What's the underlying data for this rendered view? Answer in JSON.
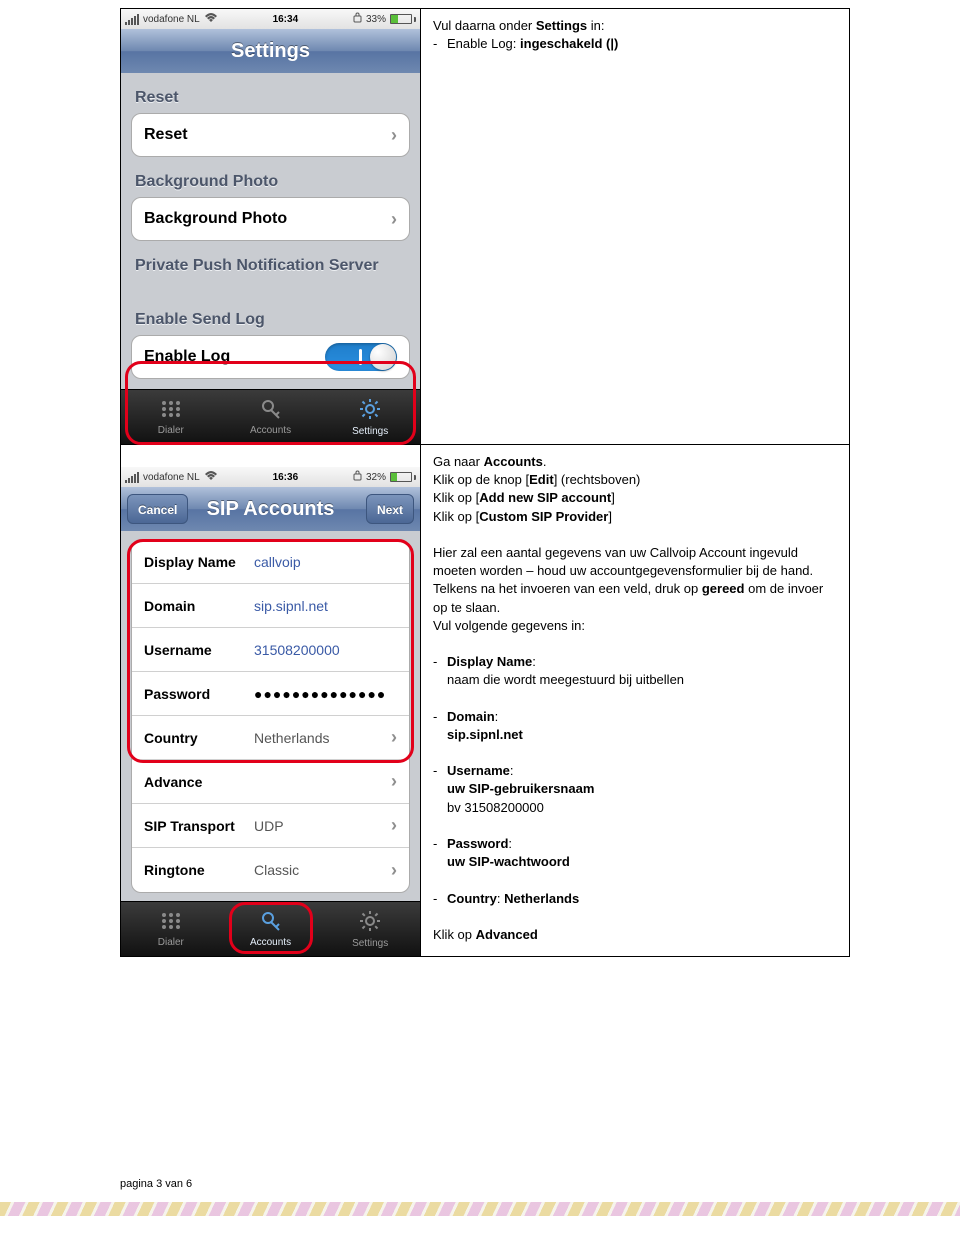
{
  "row1": {
    "statusbar": {
      "carrier": "vodafone NL",
      "time": "16:34",
      "battery_pct": "33%"
    },
    "navbar_title": "Settings",
    "groups": {
      "reset": {
        "header": "Reset",
        "cell": "Reset"
      },
      "bg": {
        "header": "Background Photo",
        "cell": "Background Photo"
      },
      "push": {
        "header": "Private Push Notification Server"
      },
      "log": {
        "header": "Enable Send Log",
        "cell": "Enable Log"
      }
    },
    "tabs": {
      "dialer": "Dialer",
      "accounts": "Accounts",
      "settings": "Settings"
    },
    "text": {
      "line1_a": "Vul daarna onder ",
      "line1_b": "Settings",
      "line1_c": " in:",
      "bullet_a": "Enable Log: ",
      "bullet_b": "ingeschakeld (|)"
    }
  },
  "row2": {
    "statusbar": {
      "carrier": "vodafone NL",
      "time": "16:36",
      "battery_pct": "32%"
    },
    "nav": {
      "left": "Cancel",
      "title": "SIP Accounts",
      "right": "Next"
    },
    "form": {
      "display_name_l": "Display Name",
      "display_name_v": "callvoip",
      "domain_l": "Domain",
      "domain_v": "sip.sipnl.net",
      "username_l": "Username",
      "username_v": "31508200000",
      "password_l": "Password",
      "password_v": "●●●●●●●●●●●●●●",
      "country_l": "Country",
      "country_v": "Netherlands",
      "advance_l": "Advance",
      "siptrans_l": "SIP Transport",
      "siptrans_v": "UDP",
      "ringtone_l": "Ringtone",
      "ringtone_v": "Classic"
    },
    "tabs": {
      "dialer": "Dialer",
      "accounts": "Accounts",
      "settings": "Settings"
    },
    "text": {
      "ga_a": "Ga naar ",
      "ga_b": "Accounts",
      "ga_c": ".",
      "klik1_a": "Klik op de knop [",
      "klik1_b": "Edit",
      "klik1_c": "] (rechtsboven)",
      "klik2_a": "Klik op [",
      "klik2_b": "Add new SIP account",
      "klik2_c": "]",
      "klik3_a": "Klik op [",
      "klik3_b": "Custom SIP Provider",
      "klik3_c": "]",
      "para1": "Hier zal een aantal gegevens van uw Callvoip Account ingevuld moeten worden – houd uw accountgegevensformulier bij de hand. Telkens na het invoeren van een veld, druk op ",
      "para1_b": "gereed",
      "para1_c": " om de invoer op te slaan.",
      "para2": "Vul volgende gegevens in:",
      "b_disp_h": "Display Name",
      "b_disp_t": "naam die wordt meegestuurd bij uitbellen",
      "b_dom_h": "Domain",
      "b_dom_t": "sip.sipnl.net",
      "b_usr_h": "Username",
      "b_usr_t1": "uw SIP-gebruikersnaam",
      "b_usr_t2": "bv 31508200000",
      "b_pwd_h": "Password",
      "b_pwd_t": "uw SIP-wachtwoord",
      "b_cty_h": "Country",
      "b_cty_v": "Netherlands",
      "klik4_a": "Klik op ",
      "klik4_b": "Advanced"
    }
  },
  "footer": "pagina 3 van 6"
}
